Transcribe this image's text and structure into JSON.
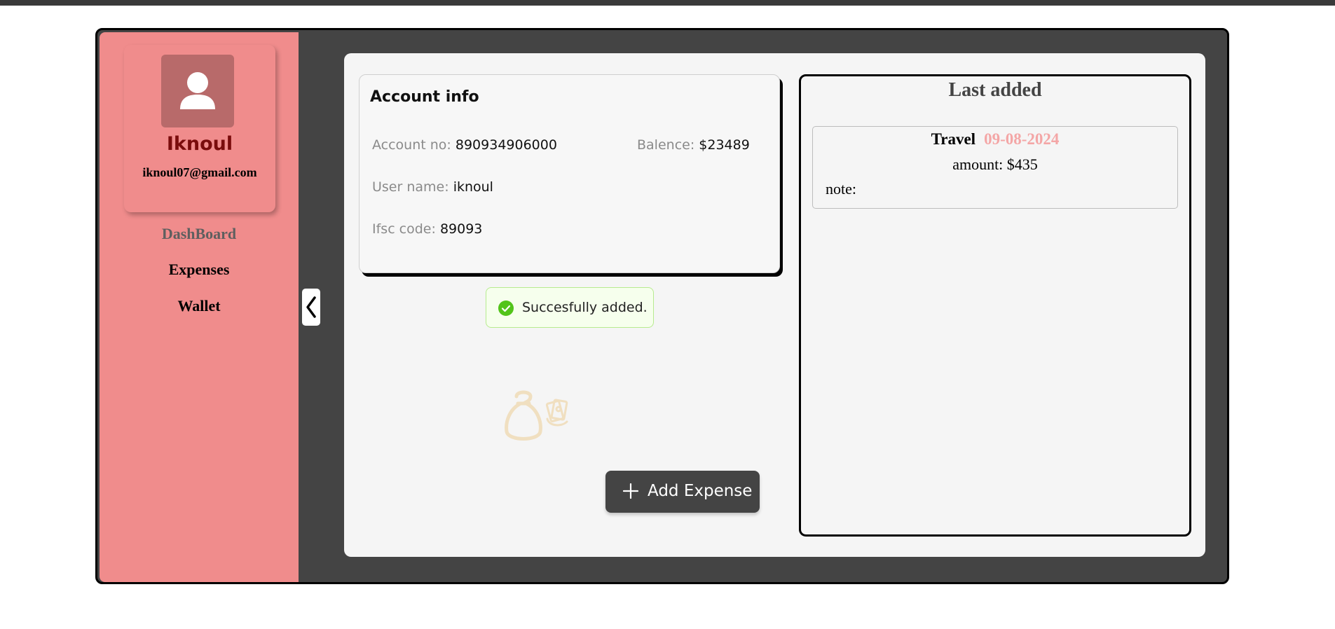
{
  "profile": {
    "name": "Iknoul",
    "email": "iknoul07@gmail.com"
  },
  "nav": {
    "dashboard": "DashBoard",
    "expenses": "Expenses",
    "wallet": "Wallet"
  },
  "account": {
    "title": "Account info",
    "account_no_label": "Account no:",
    "account_no": "890934906000",
    "balance_label": "Balence:",
    "balance": "$23489",
    "username_label": "User name:",
    "username": "iknoul",
    "ifsc_label": "Ifsc code:",
    "ifsc": "89093"
  },
  "toast": {
    "message": "Succesfully added."
  },
  "actions": {
    "add_expense_label": "Add Expense"
  },
  "last_added": {
    "title": "Last added",
    "items": [
      {
        "category": "Travel",
        "date": "09-08-2024",
        "amount_text": "amount: $435",
        "note_text": "note:"
      }
    ]
  },
  "colors": {
    "sidebar": "#f08c8c",
    "app_frame": "#444444",
    "panel": "#f5f5f5",
    "name_red": "#7a0c0c",
    "date_pink": "#f4a6a6",
    "success_green": "#52c41a"
  },
  "icons": {
    "avatar": "user-icon",
    "collapse": "chevron-left-icon",
    "toast": "check-circle-icon",
    "add": "plus-icon",
    "illustration": "money-bag-icon"
  }
}
